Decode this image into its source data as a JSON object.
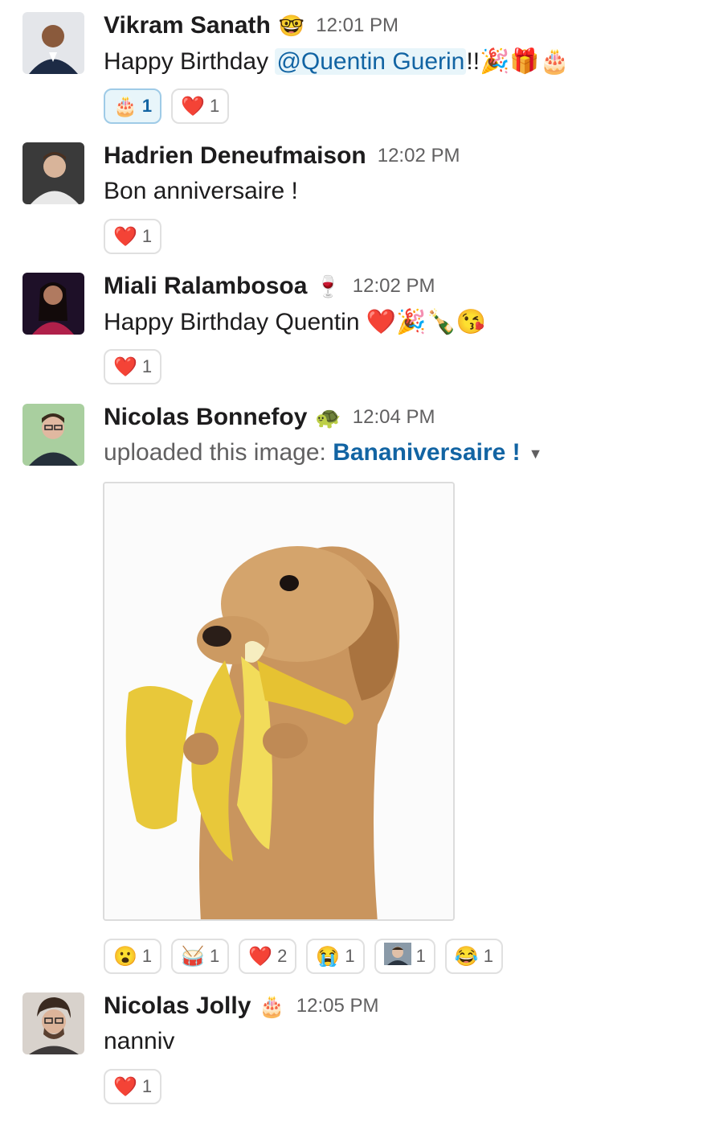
{
  "messages": [
    {
      "name": "Vikram Sanath",
      "status_emoji": "🤓",
      "time": "12:01 PM",
      "text_before": "Happy Birthday ",
      "mention": "@Quentin Guerin",
      "text_after": "!!",
      "emojis": "🎉🎁🎂",
      "reactions": [
        {
          "emoji": "🎂",
          "count": "1",
          "active": true
        },
        {
          "emoji": "❤️",
          "count": "1",
          "active": false
        }
      ]
    },
    {
      "name": "Hadrien Deneufmaison",
      "time": "12:02 PM",
      "text": "Bon anniversaire !",
      "reactions": [
        {
          "emoji": "❤️",
          "count": "1"
        }
      ]
    },
    {
      "name": "Miali Ralambosoa",
      "status_emoji": "🍷",
      "time": "12:02 PM",
      "text": "Happy Birthday Quentin",
      "emojis": "❤️🎉🍾😘",
      "reactions": [
        {
          "emoji": "❤️",
          "count": "1"
        }
      ]
    },
    {
      "name": "Nicolas Bonnefoy",
      "status_emoji": "🐢",
      "time": "12:04 PM",
      "upload_prefix": "uploaded this image: ",
      "file_name": "Bananiversaire !",
      "reactions": [
        {
          "emoji": "😮",
          "count": "1"
        },
        {
          "emoji": "🥁",
          "count": "1"
        },
        {
          "emoji": "❤️",
          "count": "2"
        },
        {
          "emoji": "😭",
          "count": "1"
        },
        {
          "emoji": "custom-face",
          "count": "1"
        },
        {
          "emoji": "😂",
          "count": "1"
        }
      ]
    },
    {
      "name": "Nicolas Jolly",
      "status_emoji": "🎂",
      "time": "12:05 PM",
      "text": "nanniv",
      "reactions": [
        {
          "emoji": "❤️",
          "count": "1"
        }
      ]
    }
  ]
}
